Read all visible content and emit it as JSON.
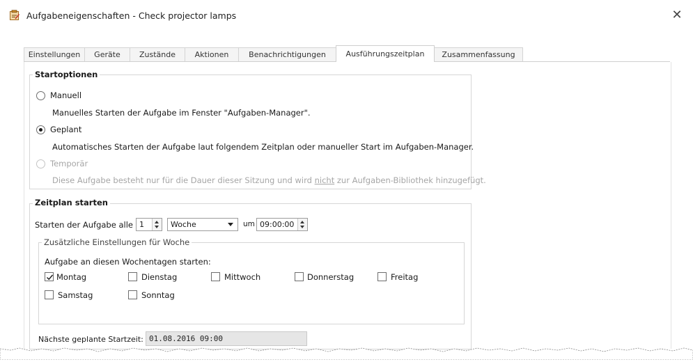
{
  "window": {
    "title": "Aufgabeneigenschaften - Check projector lamps",
    "close_symbol": "✕"
  },
  "tabs": [
    {
      "label": "Einstellungen"
    },
    {
      "label": "Geräte"
    },
    {
      "label": "Zustände"
    },
    {
      "label": "Aktionen"
    },
    {
      "label": "Benachrichtigungen"
    },
    {
      "label": "Ausführungszeitplan",
      "active": true
    },
    {
      "label": "Zusammenfassung"
    }
  ],
  "start_options": {
    "title": "Startoptionen",
    "manual": {
      "label": "Manuell",
      "description": "Manuelles Starten der Aufgabe im Fenster \"Aufgaben-Manager\".",
      "checked": false
    },
    "scheduled": {
      "label": "Geplant",
      "description": "Automatisches Starten der Aufgabe laut folgendem Zeitplan oder manueller Start im Aufgaben-Manager.",
      "checked": true
    },
    "temporary": {
      "label": "Temporär",
      "description_before": "Diese Aufgabe besteht nur für die Dauer dieser Sitzung und wird ",
      "description_emph": "nicht",
      "description_after": " zur Aufgaben-Bibliothek hinzugefügt.",
      "disabled": true
    }
  },
  "schedule": {
    "title": "Zeitplan starten",
    "start_label": "Starten der Aufgabe alle",
    "interval_value": "1",
    "unit_value": "Woche",
    "at_label": "um",
    "time_value": "09:00:00",
    "extra": {
      "title": "Zusätzliche Einstellungen für Woche",
      "weekdays_label": "Aufgabe an diesen Wochentagen starten:",
      "days": [
        {
          "label": "Montag",
          "checked": true
        },
        {
          "label": "Dienstag",
          "checked": false
        },
        {
          "label": "Mittwoch",
          "checked": false
        },
        {
          "label": "Donnerstag",
          "checked": false
        },
        {
          "label": "Freitag",
          "checked": false
        },
        {
          "label": "Samstag",
          "checked": false
        },
        {
          "label": "Sonntag",
          "checked": false
        }
      ]
    },
    "next_start_label": "Nächste geplante Startzeit:",
    "next_start_value": "01.08.2016 09:00"
  }
}
